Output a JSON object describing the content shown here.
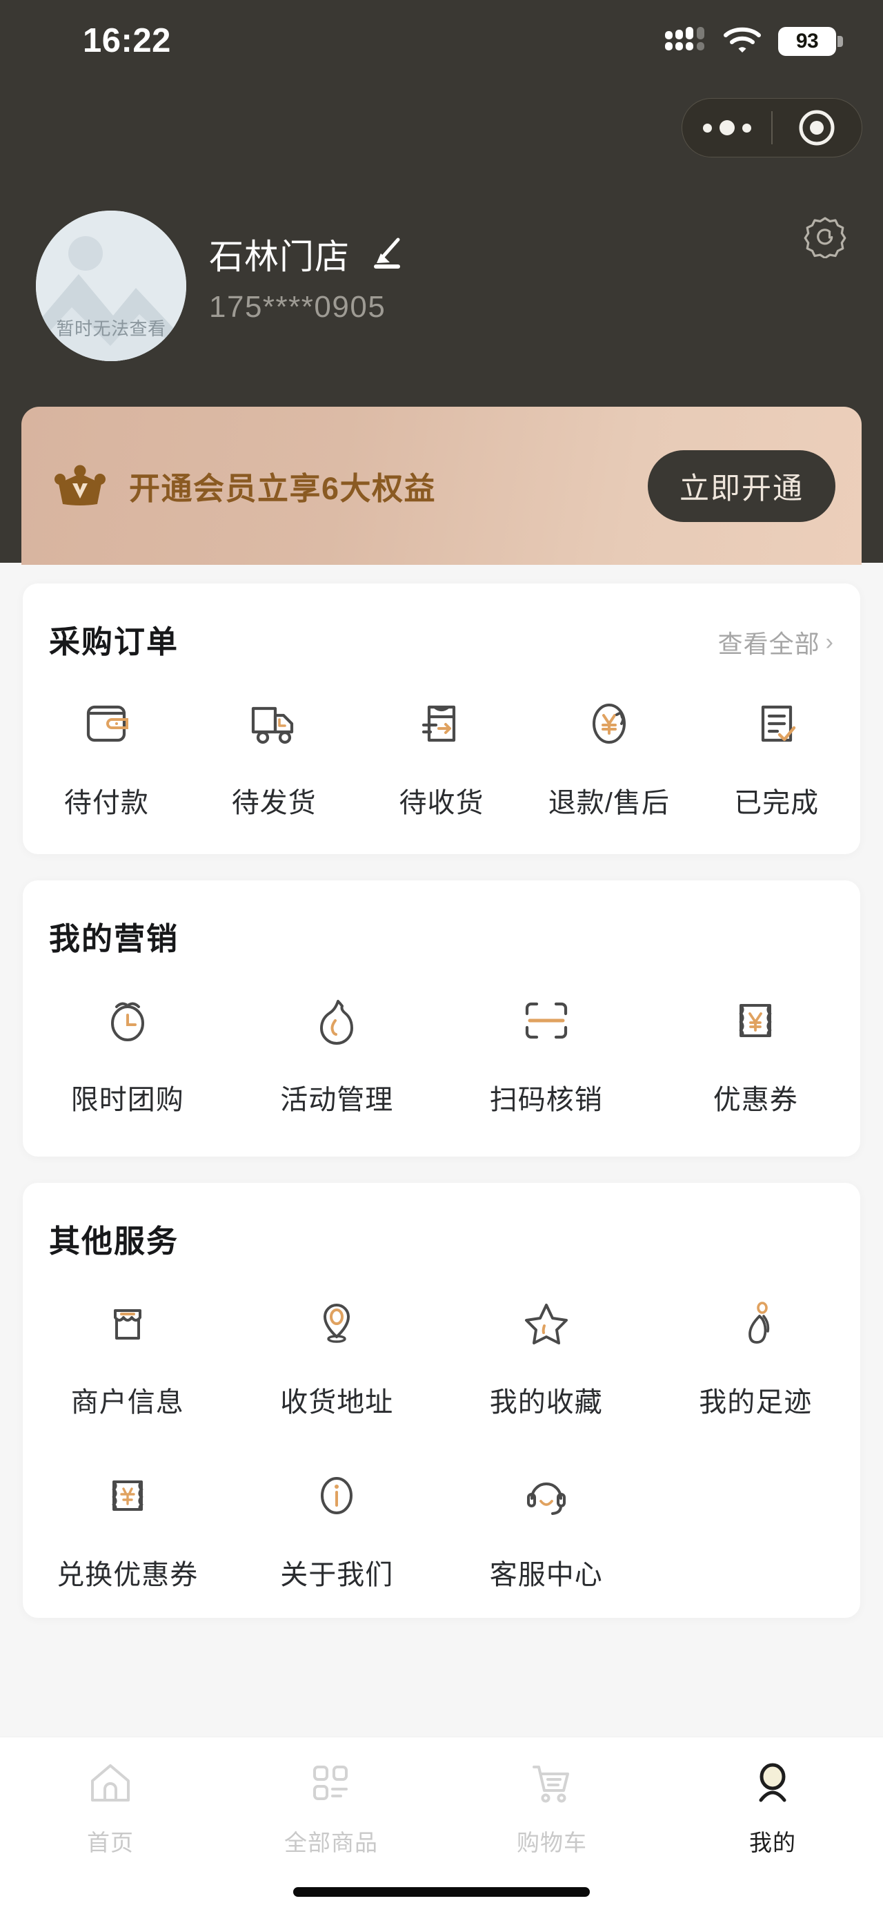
{
  "status_bar": {
    "time": "16:22",
    "battery_level": "93",
    "signal_icon": "signal-bars-icon",
    "wifi_icon": "wifi-icon",
    "battery_icon": "battery-icon"
  },
  "capsule": {
    "menu_icon": "more-dots-icon",
    "target_icon": "target-circle-icon"
  },
  "profile": {
    "avatar_note": "暂时无法查看",
    "name": "石林门店",
    "edit_icon": "pencil-edit-icon",
    "phone": "175****0905",
    "settings_icon": "gear-icon"
  },
  "member_banner": {
    "crown_icon": "crown-icon",
    "text": "开通会员立享6大权益",
    "button_label": "立即开通",
    "bg_start": "#d8b49f",
    "bg_end": "#eccfbb",
    "text_color": "#8a5a22",
    "button_bg": "#3a3833"
  },
  "orders_card": {
    "title": "采购订单",
    "view_all": "查看全部",
    "chevron_icon": "chevron-right-icon",
    "items": [
      {
        "label": "待付款",
        "icon": "wallet-icon"
      },
      {
        "label": "待发货",
        "icon": "truck-icon"
      },
      {
        "label": "待收货",
        "icon": "package-arrow-icon"
      },
      {
        "label": "退款/售后",
        "icon": "refund-yen-icon"
      },
      {
        "label": "已完成",
        "icon": "checklist-icon"
      }
    ]
  },
  "marketing_card": {
    "title": "我的营销",
    "items": [
      {
        "label": "限时团购",
        "icon": "alarm-clock-icon"
      },
      {
        "label": "活动管理",
        "icon": "flame-icon"
      },
      {
        "label": "扫码核销",
        "icon": "scan-frame-icon"
      },
      {
        "label": "优惠券",
        "icon": "coupon-yen-icon"
      }
    ]
  },
  "other_card": {
    "title": "其他服务",
    "row1": [
      {
        "label": "商户信息",
        "icon": "storefront-icon"
      },
      {
        "label": "收货地址",
        "icon": "location-pin-icon"
      },
      {
        "label": "我的收藏",
        "icon": "star-icon"
      },
      {
        "label": "我的足迹",
        "icon": "footprint-icon"
      }
    ],
    "row2": [
      {
        "label": "兑换优惠券",
        "icon": "redeem-ticket-icon"
      },
      {
        "label": "关于我们",
        "icon": "info-circle-icon"
      },
      {
        "label": "客服中心",
        "icon": "headset-icon"
      }
    ]
  },
  "tabbar": {
    "items": [
      {
        "label": "首页",
        "icon": "home-icon",
        "active": false
      },
      {
        "label": "全部商品",
        "icon": "grid-icon",
        "active": false
      },
      {
        "label": "购物车",
        "icon": "cart-icon",
        "active": false
      },
      {
        "label": "我的",
        "icon": "person-icon",
        "active": true
      }
    ]
  },
  "colors": {
    "header_bg": "#3a3833",
    "page_bg": "#f6f6f6",
    "accent_orange": "#e0a260",
    "icon_dark": "#4a4a4a"
  }
}
